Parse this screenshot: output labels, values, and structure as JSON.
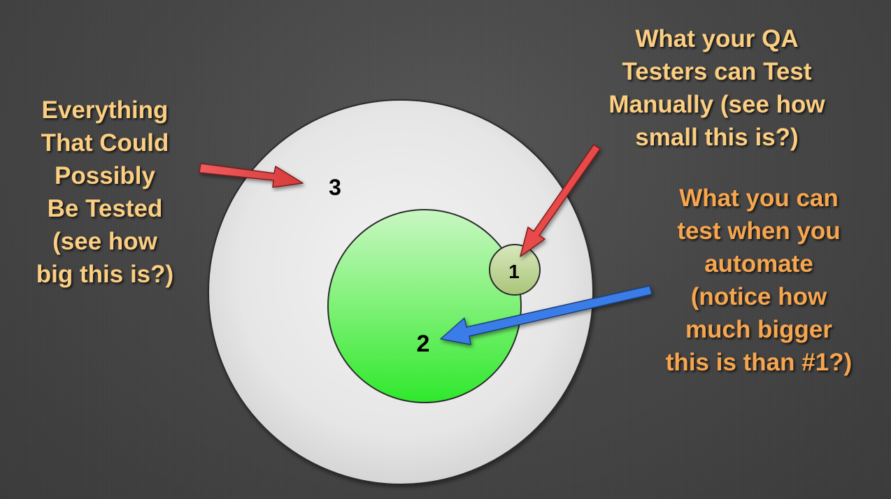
{
  "labels": {
    "region_3": "3",
    "region_2": "2",
    "region_1": "1"
  },
  "callouts": {
    "everything": {
      "lines": [
        "Everything",
        "That Could",
        "Possibly",
        "Be Tested",
        "(see how",
        "big this is?)"
      ],
      "color": "#fbce82"
    },
    "qa_manual": {
      "lines": [
        "What your QA",
        "Testers can Test",
        "Manually (see how",
        "small this is?)"
      ],
      "color": "#fbce82"
    },
    "automate": {
      "lines": [
        "What you can",
        "test when you",
        "automate",
        "(notice how",
        "much bigger",
        "this is than #1?)"
      ],
      "color": "#f7a64f"
    }
  },
  "colors": {
    "background": "#474747",
    "outer_circle": "#e6e6e6",
    "middle_circle": "#3ef03c",
    "inner_circle": "#bcd48e",
    "red_arrow": "#e84a4a",
    "blue_arrow": "#3b7de8"
  }
}
